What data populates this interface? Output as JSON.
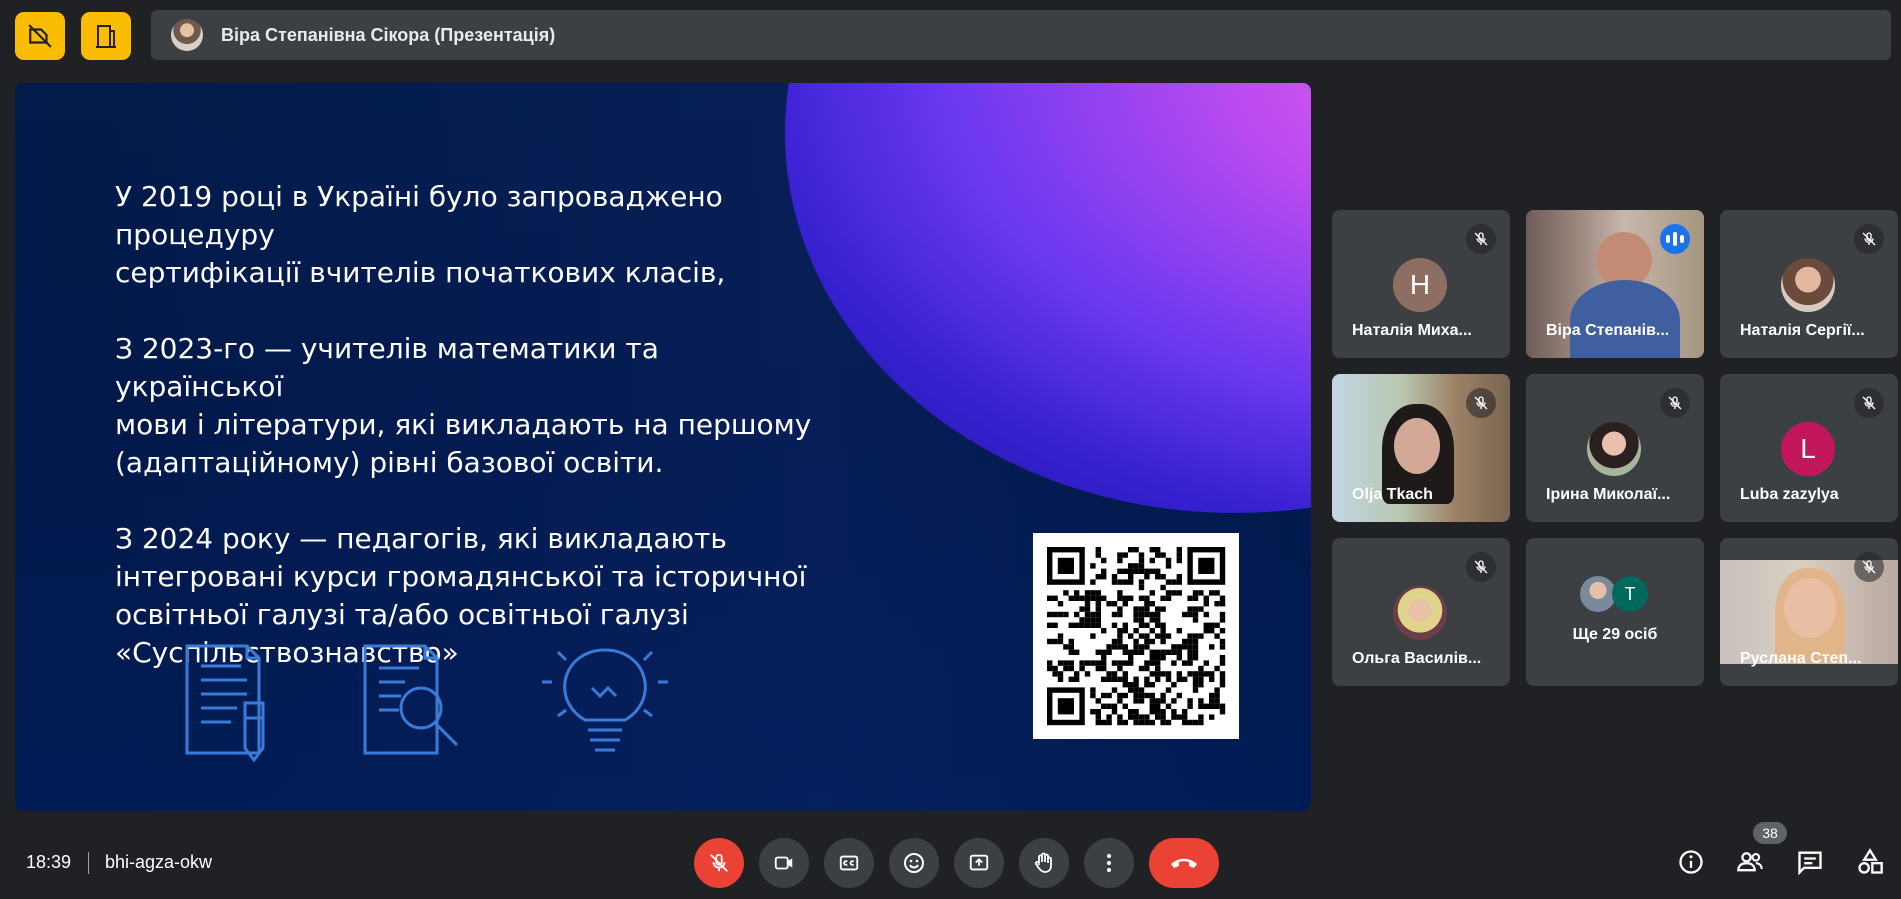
{
  "presenter": {
    "name": "Віра Степанівна Сікора (Презентація)"
  },
  "slide": {
    "paragraphs": [
      "У 2019 році в Україні було запроваджено процедуру\nсертифікації вчителів початкових класів,",
      "З 2023-го — учителів математики та української\nмови і літератури, які викладають на першому\n(адаптаційному) рівні базової освіти.",
      "З 2024 року  — педагогів, які викладають\nінтегровані курси громадянської та історичної\nосвітньої галузі та/або освітньої галузі\n«Суспільствознавство»"
    ],
    "icons": [
      "document-pencil-icon",
      "document-search-icon",
      "lightbulb-icon"
    ]
  },
  "participants": [
    {
      "name": "Наталія Миха...",
      "initial": "Н",
      "avatar_color": "#8d6e63",
      "muted": true
    },
    {
      "name": "Віра Степанів...",
      "speaking": true,
      "video": true
    },
    {
      "name": "Наталія Сергії...",
      "muted": true
    },
    {
      "name": "Olja Tkach",
      "muted": true,
      "video": true
    },
    {
      "name": "Ірина Миколаї...",
      "muted": true
    },
    {
      "name": "Luba zazylya",
      "initial": "L",
      "avatar_color": "#c2185b",
      "muted": true
    },
    {
      "name": "Ольга Василів...",
      "muted": true
    },
    {
      "name": "Ще 29 осіб",
      "extra_initial": "T"
    },
    {
      "name": "Руслана Степ...",
      "muted": true,
      "video": true
    }
  ],
  "bottom": {
    "time": "18:39",
    "meeting_code": "bhi-agza-okw",
    "participant_count": "38"
  },
  "colors": {
    "accent_yellow": "#fbbc04",
    "end_red": "#ea4335",
    "active_blue": "#8ab4f8"
  }
}
